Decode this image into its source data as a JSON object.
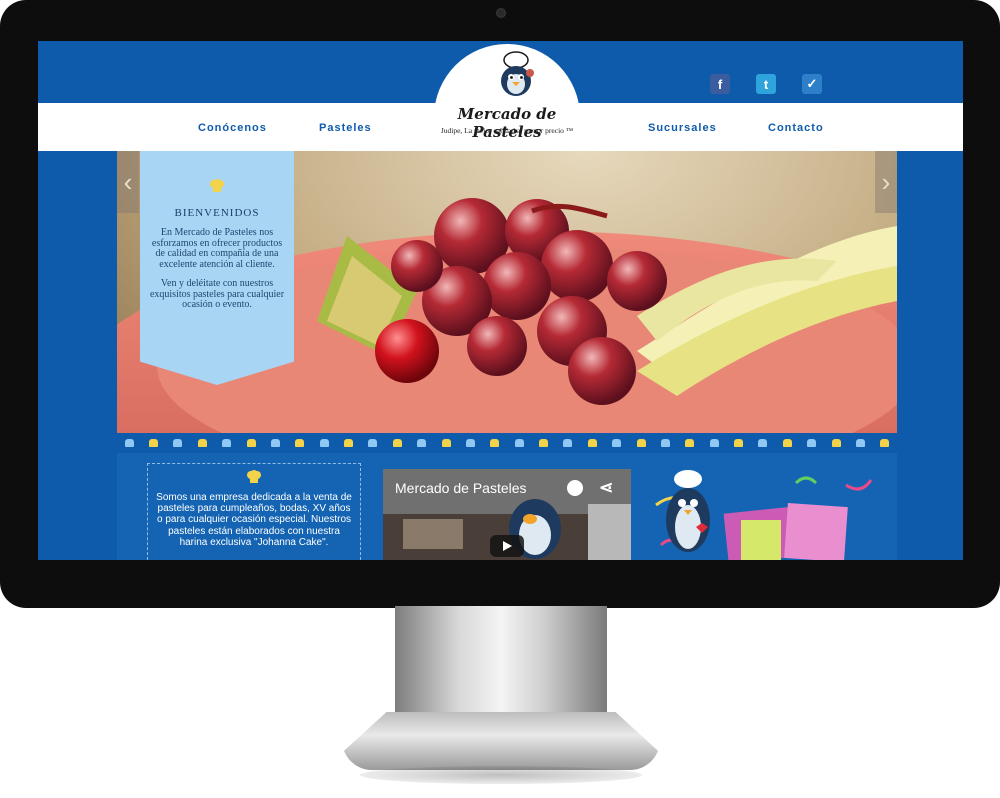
{
  "site": {
    "logo": {
      "title": "Mercado de Pasteles",
      "tagline": "Judipe, La mejor calidad al menor precio ™"
    },
    "nav": {
      "left": [
        "Conócenos",
        "Pasteles"
      ],
      "right": [
        "Sucursales",
        "Contacto"
      ]
    },
    "social": [
      {
        "icon": "facebook-icon",
        "glyph": "f",
        "color": "#3b5c9e"
      },
      {
        "icon": "twitter-icon",
        "glyph": "t",
        "color": "#2fa3db"
      },
      {
        "icon": "foursquare-icon",
        "glyph": "✓",
        "color": "#2c7fc8"
      }
    ],
    "banner": {
      "title": "BIENVENIDOS",
      "paragraphs": [
        "En Mercado de Pasteles nos esforzamos en ofrecer productos de calidad en compañía de una excelente atención al cliente.",
        "Ven y deléitate con nuestros exquisitos pasteles para cualquier ocasión o evento."
      ]
    },
    "slider": {
      "prev_glyph": "‹",
      "next_glyph": "›"
    },
    "about": {
      "text": "Somos una empresa dedicada a la venta de pasteles para cumpleaños, bodas, XV años o para cualquier ocasión especial. Nuestros pasteles están elaborados con nuestra harina exclusiva \"Johanna Cake\"."
    },
    "video": {
      "title": "Mercado de Pasteles"
    },
    "colors": {
      "primary": "#0f5bab",
      "banner": "#a9d5f5",
      "accent_yellow": "#f2d34a",
      "accent_light_blue": "#8fc8f2"
    }
  }
}
